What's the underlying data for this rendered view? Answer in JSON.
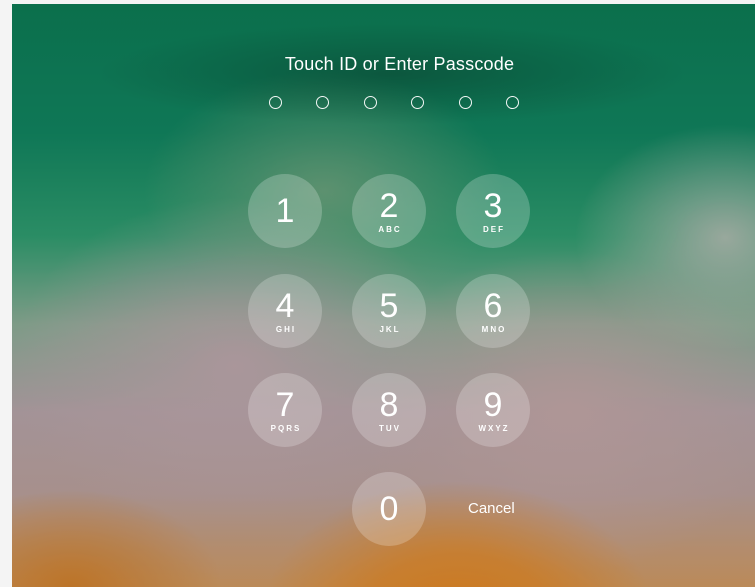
{
  "lockscreen": {
    "title": "Touch ID or Enter Passcode",
    "passcode_length": 6,
    "keys": [
      {
        "digit": "1",
        "letters": ""
      },
      {
        "digit": "2",
        "letters": "ABC"
      },
      {
        "digit": "3",
        "letters": "DEF"
      },
      {
        "digit": "4",
        "letters": "GHI"
      },
      {
        "digit": "5",
        "letters": "JKL"
      },
      {
        "digit": "6",
        "letters": "MNO"
      },
      {
        "digit": "7",
        "letters": "PQRS"
      },
      {
        "digit": "8",
        "letters": "TUV"
      },
      {
        "digit": "9",
        "letters": "WXYZ"
      },
      {
        "digit": "0",
        "letters": ""
      }
    ],
    "cancel_label": "Cancel"
  }
}
